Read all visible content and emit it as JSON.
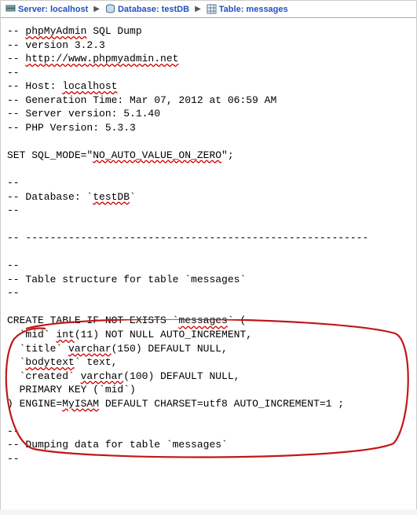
{
  "breadcrumb": {
    "server_label": "Server: ",
    "server_value": "localhost",
    "db_label": "Database: ",
    "db_value": "testDB",
    "table_label": "Table: ",
    "table_value": "messages"
  },
  "sql": {
    "l1a": "-- ",
    "l1b": "phpMyAdmin",
    "l1c": " SQL Dump",
    "l2": "-- version 3.2.3",
    "l3a": "-- ",
    "l3b": "http://www.phpmyadmin.net",
    "l4": "--",
    "l5a": "-- Host: ",
    "l5b": "localhost",
    "l6": "-- Generation Time: Mar 07, 2012 at 06:59 AM",
    "l7": "-- Server version: 5.1.40",
    "l8": "-- PHP Version: 5.3.3",
    "l9a": "SET SQL_MODE=\"",
    "l9b": "NO_AUTO_VALUE_ON_ZERO",
    "l9c": "\";",
    "l10": "--",
    "l11a": "-- Database: `",
    "l11b": "testDB",
    "l11c": "`",
    "l12": "--",
    "l13": "-- --------------------------------------------------------",
    "l14": "--",
    "l15": "-- Table structure for table `messages`",
    "l16": "--",
    "c1a": "CREATE TABLE IF NOT EXISTS `",
    "c1b": "messages",
    "c1c": "` (",
    "c2a": "  `mid` ",
    "c2b": "int",
    "c2c": "(11) NOT NULL AUTO_INCREMENT,",
    "c3a": "  `title` ",
    "c3b": "varchar",
    "c3c": "(150) DEFAULT NULL,",
    "c4a": "  `",
    "c4b": "bodytext",
    "c4c": "` text,",
    "c5a": "  `created` ",
    "c5b": "varchar",
    "c5c": "(100) DEFAULT NULL,",
    "c6": "  PRIMARY KEY (`mid`)",
    "c7a": ") ENGINE=",
    "c7b": "MyISAM",
    "c7c": " DEFAULT CHARSET=utf8 AUTO_INCREMENT=1 ;",
    "d1": "--",
    "d2": "-- Dumping data for table `messages`",
    "d3": "--"
  }
}
